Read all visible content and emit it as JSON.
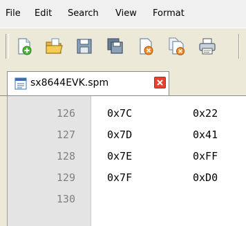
{
  "menu": [
    "File",
    "Edit",
    "Search",
    "View",
    "Format"
  ],
  "toolbar": {
    "buttons": [
      "new-file-icon",
      "open-folder-icon",
      "save-icon",
      "save-all-icon",
      "close-file-icon",
      "close-all-icon",
      "print-icon"
    ]
  },
  "tab": {
    "label": "sx8644EVK.spm",
    "icon": "document-icon",
    "close_icon": "close-icon"
  },
  "lines": [
    {
      "num": "126",
      "col1": "0x7C",
      "col2": "0x22"
    },
    {
      "num": "127",
      "col1": "0x7D",
      "col2": "0x41"
    },
    {
      "num": "128",
      "col1": "0x7E",
      "col2": "0xFF"
    },
    {
      "num": "129",
      "col1": "0x7F",
      "col2": "0xD0"
    },
    {
      "num": "130",
      "col1": "",
      "col2": ""
    }
  ]
}
